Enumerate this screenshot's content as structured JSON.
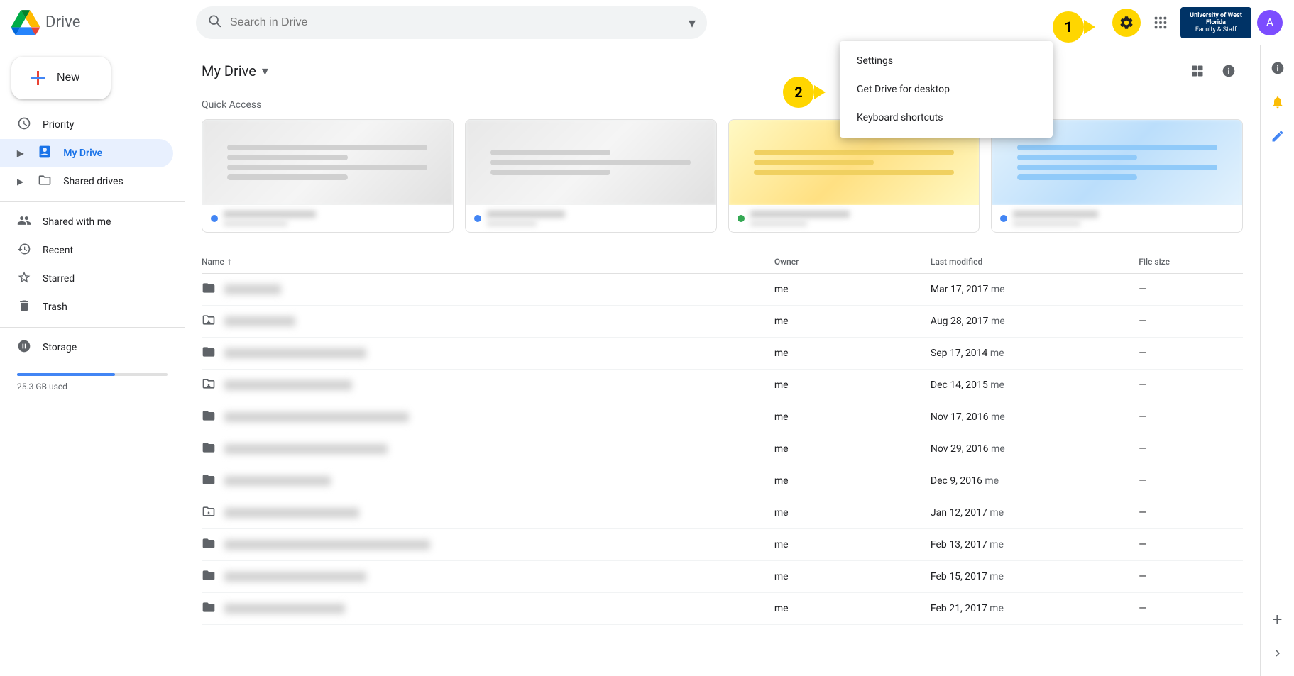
{
  "header": {
    "logo_text": "Drive",
    "search_placeholder": "Search in Drive",
    "step1_label": "1",
    "step2_label": "2",
    "university_name": "University of West Florida",
    "university_sub": "Faculty & Staff",
    "apps_icon": "⋮⋮⋮",
    "help_icon": "?"
  },
  "sidebar": {
    "new_label": "New",
    "items": [
      {
        "id": "priority",
        "label": "Priority",
        "icon": "☑",
        "active": false
      },
      {
        "id": "my-drive",
        "label": "My Drive",
        "icon": "🗂",
        "active": true,
        "expandable": true
      },
      {
        "id": "shared-drives",
        "label": "Shared drives",
        "icon": "🗃",
        "active": false,
        "expandable": true
      },
      {
        "id": "shared-with-me",
        "label": "Shared with me",
        "icon": "👥",
        "active": false
      },
      {
        "id": "recent",
        "label": "Recent",
        "icon": "🕐",
        "active": false
      },
      {
        "id": "starred",
        "label": "Starred",
        "icon": "☆",
        "active": false
      },
      {
        "id": "trash",
        "label": "Trash",
        "icon": "🗑",
        "active": false
      }
    ],
    "storage_label": "Storage",
    "storage_used": "25.3 GB used",
    "storage_percent": 65
  },
  "main": {
    "drive_title": "My Drive",
    "quick_access_label": "Quick Access",
    "cards": [
      {
        "dot_color": "#4285f4",
        "name_width": 130,
        "sub_width": 90
      },
      {
        "dot_color": "#4285f4",
        "name_width": 110,
        "sub_width": 70
      },
      {
        "dot_color": "#34a853",
        "name_width": 140,
        "sub_width": 80
      },
      {
        "dot_color": "#4285f4",
        "name_width": 120,
        "sub_width": 95
      }
    ],
    "table": {
      "columns": [
        {
          "id": "name",
          "label": "Name",
          "sortable": true,
          "sort_dir": "asc"
        },
        {
          "id": "owner",
          "label": "Owner",
          "sortable": false
        },
        {
          "id": "modified",
          "label": "Last modified",
          "sortable": false
        },
        {
          "id": "size",
          "label": "File size",
          "sortable": false
        }
      ],
      "rows": [
        {
          "type": "folder",
          "shared": false,
          "name_width": 80,
          "owner": "me",
          "modified": "Mar 17, 2017",
          "modifier": "me",
          "size": "—"
        },
        {
          "type": "folder",
          "shared": true,
          "name_width": 100,
          "owner": "me",
          "modified": "Aug 28, 2017",
          "modifier": "me",
          "size": "—"
        },
        {
          "type": "folder",
          "shared": false,
          "name_width": 200,
          "owner": "me",
          "modified": "Sep 17, 2014",
          "modifier": "me",
          "size": "—"
        },
        {
          "type": "folder",
          "shared": true,
          "name_width": 180,
          "owner": "me",
          "modified": "Dec 14, 2015",
          "modifier": "me",
          "size": "—"
        },
        {
          "type": "folder",
          "shared": false,
          "name_width": 260,
          "owner": "me",
          "modified": "Nov 17, 2016",
          "modifier": "me",
          "size": "—"
        },
        {
          "type": "folder",
          "shared": false,
          "name_width": 230,
          "owner": "me",
          "modified": "Nov 29, 2016",
          "modifier": "me",
          "size": "—"
        },
        {
          "type": "folder",
          "shared": false,
          "name_width": 150,
          "owner": "me",
          "modified": "Dec 9, 2016",
          "modifier": "me",
          "size": "—"
        },
        {
          "type": "folder",
          "shared": true,
          "name_width": 190,
          "owner": "me",
          "modified": "Jan 12, 2017",
          "modifier": "me",
          "size": "—"
        },
        {
          "type": "folder",
          "shared": false,
          "name_width": 290,
          "owner": "me",
          "modified": "Feb 13, 2017",
          "modifier": "me",
          "size": "—"
        },
        {
          "type": "folder",
          "shared": false,
          "name_width": 200,
          "owner": "me",
          "modified": "Feb 15, 2017",
          "modifier": "me",
          "size": "—"
        },
        {
          "type": "folder",
          "shared": false,
          "name_width": 170,
          "owner": "me",
          "modified": "Feb 21, 2017",
          "modifier": "me",
          "size": "—"
        }
      ]
    }
  },
  "dropdown": {
    "items": [
      {
        "id": "settings",
        "label": "Settings"
      },
      {
        "id": "get-drive-desktop",
        "label": "Get Drive for desktop"
      },
      {
        "id": "keyboard-shortcuts",
        "label": "Keyboard shortcuts"
      }
    ]
  },
  "right_sidebar": {
    "icons": [
      {
        "id": "details",
        "glyph": "ℹ",
        "active": false
      },
      {
        "id": "activity",
        "glyph": "🔔",
        "active": true
      },
      {
        "id": "edit",
        "glyph": "✏",
        "active": false
      }
    ]
  }
}
